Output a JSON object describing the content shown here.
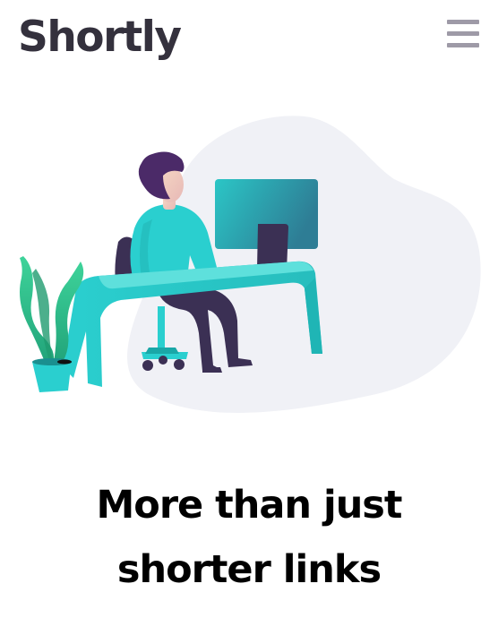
{
  "header": {
    "logo_text": "Shortly",
    "menu_icon": "hamburger-menu-icon"
  },
  "hero": {
    "illustration": "person-working-at-desk-illustration",
    "headline_lines": [
      "More than just",
      "shorter links"
    ]
  },
  "colors": {
    "text_dark": "#34313d",
    "menu_gray": "#9e9aa7",
    "blob_bg": "#f0f1f6",
    "teal": "#2acfcf",
    "teal_dark": "#1aa7a7",
    "purple_dark": "#3b3054",
    "headline": "#000000"
  }
}
